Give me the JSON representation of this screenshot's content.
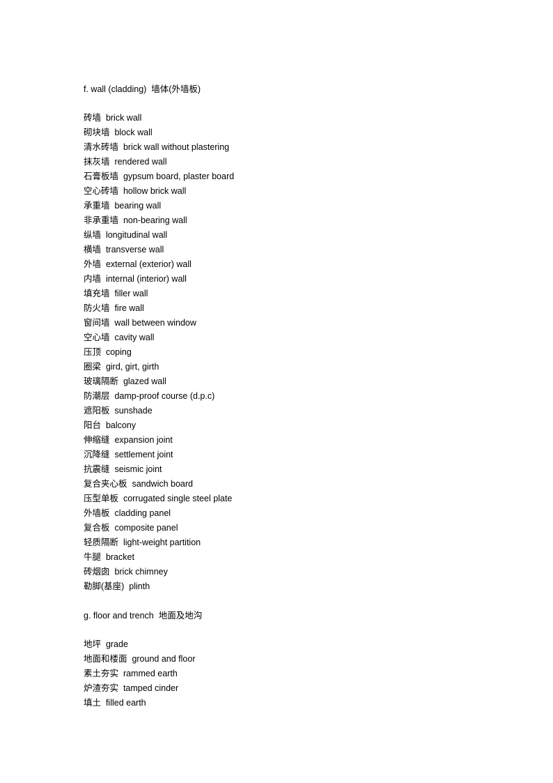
{
  "document": {
    "background_color": "#ffffff",
    "text_color": "#000000",
    "sections": [
      {
        "id": "section-f-wall-cladding",
        "heading": "f. wall (cladding)  墙体(外墙板)",
        "entries": [
          "砖墙  brick wall",
          "砌块墙  block wall",
          "清水砖墙  brick wall without plastering",
          "抹灰墙  rendered wall",
          "石膏板墙  gypsum board, plaster board",
          "空心砖墙  hollow brick wall",
          "承重墙  bearing wall",
          "非承重墙  non-bearing wall",
          "纵墙  longitudinal wall",
          "横墙  transverse wall",
          "外墙  external (exterior) wall",
          "内墙  internal (interior) wall",
          "填充墙  filler wall",
          "防火墙  fire wall",
          "窗间墙  wall between window",
          "空心墙  cavity wall",
          "压顶  coping",
          "圈梁  gird, girt, girth",
          "玻璃隔断  glazed wall",
          "防潮层  damp-proof course (d.p.c)",
          "遮阳板  sunshade",
          "阳台  balcony",
          "伸缩缝  expansion joint",
          "沉降缝  settlement joint",
          "抗震缝  seismic joint",
          "复合夹心板  sandwich board",
          "压型单板  corrugated single steel plate",
          "外墙板  cladding panel",
          "复合板  composite panel",
          "轻质隔断  light-weight partition",
          "牛腿  bracket",
          "砖烟囱  brick chimney",
          "勒脚(基座)  plinth"
        ]
      },
      {
        "id": "section-g-floor-and-trench",
        "heading": "g. floor and trench  地面及地沟",
        "entries": [
          "地坪  grade",
          "地面和楼面  ground and floor",
          "素土夯实  rammed earth",
          "炉渣夯实  tamped cinder",
          "填土  filled earth"
        ]
      }
    ]
  }
}
